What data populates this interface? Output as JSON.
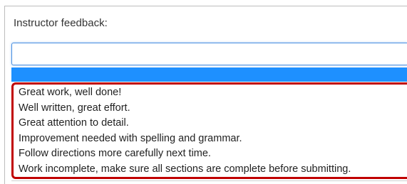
{
  "feedback": {
    "label": "Instructor feedback:",
    "selected_value": "",
    "options": [
      "Great work, well done!",
      "Well written, great effort.",
      "Great attention to detail.",
      "Improvement needed with spelling and grammar.",
      "Follow directions more carefully next time.",
      "Work incomplete, make sure all sections are complete before submitting."
    ]
  },
  "colors": {
    "highlight": "#1e90ff",
    "annotation_border": "#c00000",
    "focus_border": "#4a90e2"
  }
}
